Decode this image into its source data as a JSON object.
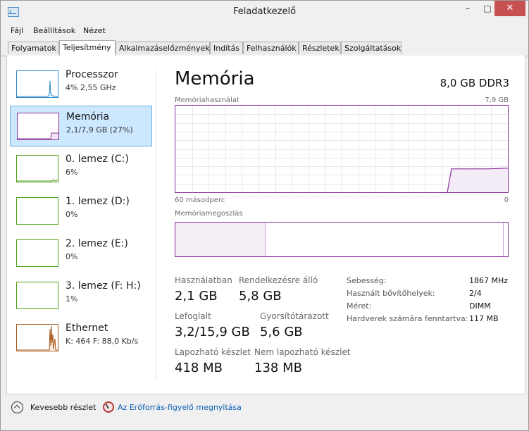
{
  "window": {
    "title": "Feladatkezelő",
    "minimize": "–",
    "maximize": "□",
    "close": "✕"
  },
  "menu": [
    "Fájl",
    "Beállítások",
    "Nézet"
  ],
  "tabs": [
    "Folyamatok",
    "Teljesítmény",
    "Alkalmazáselőzmények",
    "Indítás",
    "Felhasználók",
    "Részletek",
    "Szolgáltatások"
  ],
  "active_tab": "Teljesítmény",
  "sidebar": [
    {
      "title": "Processzor",
      "subtitle": "4% 2,55 GHz",
      "color": "#2a86c8",
      "icon": "cpu-graph-icon"
    },
    {
      "title": "Memória",
      "subtitle": "2,1/7,9 GB (27%)",
      "color": "#8b2d9c",
      "icon": "memory-graph-icon"
    },
    {
      "title": "0. lemez (C:)",
      "subtitle": "6%",
      "color": "#4da01b",
      "icon": "disk-graph-icon"
    },
    {
      "title": "1. lemez (D:)",
      "subtitle": "0%",
      "color": "#4da01b",
      "icon": "disk-graph-icon"
    },
    {
      "title": "2. lemez (E:)",
      "subtitle": "0%",
      "color": "#4da01b",
      "icon": "disk-graph-icon"
    },
    {
      "title": "3. lemez (F: H:)",
      "subtitle": "1%",
      "color": "#4da01b",
      "icon": "disk-graph-icon"
    },
    {
      "title": "Ethernet",
      "subtitle": "K: 464  F: 88,0 Kb/s",
      "color": "#a7581b",
      "icon": "network-graph-icon"
    }
  ],
  "main": {
    "title": "Memória",
    "spec": "8,0 GB DDR3",
    "usage_label": "Memóriahasználat",
    "usage_max": "7,9 GB",
    "time_left": "60 másodperc",
    "time_right": "0",
    "composition_label": "Memóriamegoszlás",
    "usage_fraction": 0.27,
    "standby_fraction": 0.985
  },
  "stats": {
    "in_use_label": "Használatban",
    "in_use": "2,1 GB",
    "available_label": "Rendelkezésre álló",
    "available": "5,8 GB",
    "committed_label": "Lefoglalt",
    "committed": "3,2/15,9 GB",
    "cached_label": "Gyorsítótárazott",
    "cached": "5,6 GB",
    "paged_label": "Lapozható készlet",
    "paged": "418 MB",
    "nonpaged_label": "Nem lapozható készlet",
    "nonpaged": "138 MB"
  },
  "details": [
    {
      "label": "Sebesség:",
      "value": "1867 MHz"
    },
    {
      "label": "Használt bővítőhelyek:",
      "value": "2/4"
    },
    {
      "label": "Méret:",
      "value": "DIMM"
    },
    {
      "label": "Hardverek számára fenntartva:",
      "value": "117 MB"
    }
  ],
  "footer": {
    "fewer_details": "Kevesebb részlet",
    "resource_monitor": "Az Erőforrás-figyelő megnyitása"
  },
  "colors": {
    "memory": "#8b2d9c",
    "cpu": "#2a86c8",
    "disk": "#4da01b",
    "ethernet": "#a7581b",
    "selected": "#cce8ff"
  }
}
